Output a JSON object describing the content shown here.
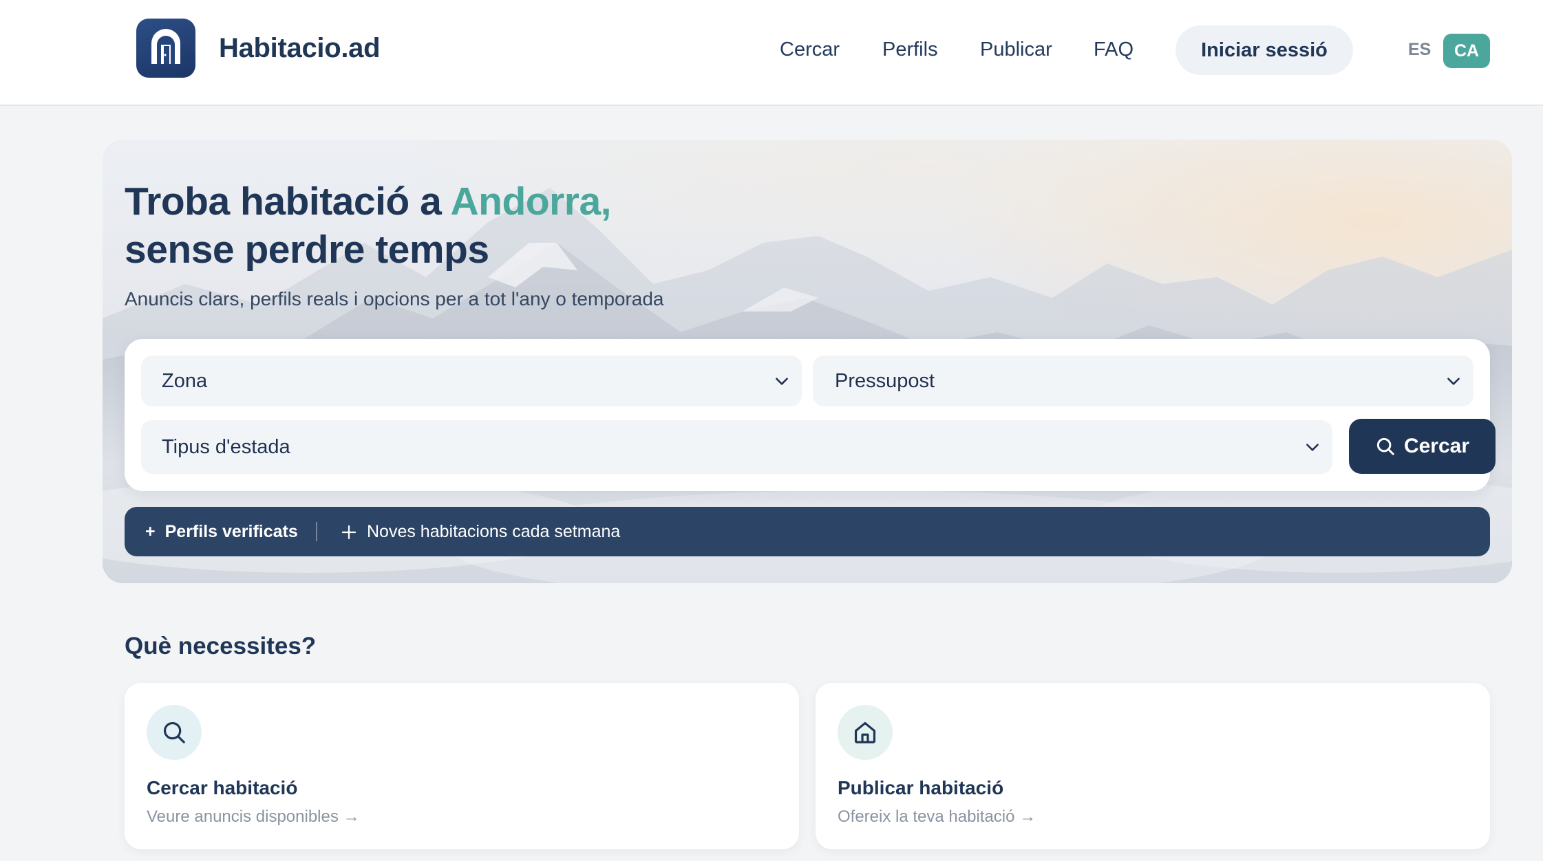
{
  "header": {
    "brand": "Habitacio.ad",
    "logo_icon": "door-icon",
    "nav": [
      {
        "label": "Cercar"
      },
      {
        "label": "Perfils"
      },
      {
        "label": "Publicar"
      },
      {
        "label": "FAQ"
      }
    ],
    "login_label": "Iniciar sessió",
    "languages": {
      "es": "ES",
      "ca": "CA",
      "active": "CA"
    }
  },
  "hero": {
    "title_part1": "Troba habitació a ",
    "title_accent": "Andorra,",
    "title_line2": "sense perdre temps",
    "subtitle": "Anuncis clars, perfils reals i opcions per a tot l'any o temporada",
    "search": {
      "zone": "Zona",
      "budget": "Pressupost",
      "stay_type": "Tipus d'estada",
      "button_label": "Cercar"
    },
    "features": [
      {
        "label": "Perfils verificats",
        "prefix": "+"
      },
      {
        "label": "Noves habitacions cada setmana",
        "icon": "plus-icon"
      }
    ]
  },
  "section": {
    "title": "Què necessites?",
    "cards": [
      {
        "title": "Cercar habitació",
        "subtitle": "Veure anuncis disponibles →",
        "icon": "search-icon"
      },
      {
        "title": "Publicar habitació",
        "subtitle": "Ofereix la teva habitació →",
        "icon": "home-icon"
      }
    ]
  },
  "colors": {
    "brand_navy": "#1f3656",
    "accent_teal": "#4ba69c",
    "feature_bar": "#2c4466"
  }
}
